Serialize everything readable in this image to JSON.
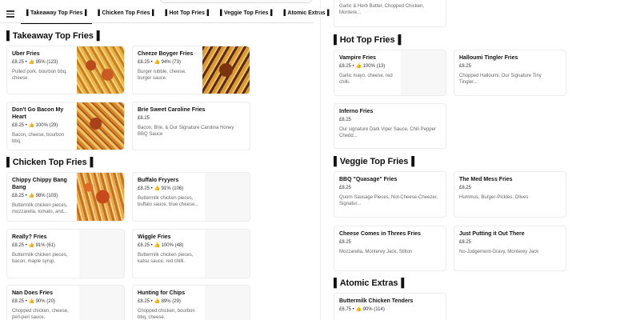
{
  "tabs": [
    {
      "label": "▌Takeaway Top Fries▐"
    },
    {
      "label": "▌Chicken Top Fries▐"
    },
    {
      "label": "▌Hot Top Fries▐"
    },
    {
      "label": "▌Veggie Top Fries▐"
    },
    {
      "label": "▌Atomic Extras▐"
    }
  ],
  "top_partial_card": {
    "desc": "Garlic & Herb Butter, Chopped Chicken, Montere..."
  },
  "sections": {
    "takeaway": {
      "title": "▌Takeaway Top Fries▐",
      "items": [
        {
          "name": "Uber Fries",
          "meta": "£8.25 • 👍 95% (123)",
          "desc": "Pulled pork, bourbon bbq, cheese."
        },
        {
          "name": "Cheeze Boyger Fries",
          "meta": "£8.25 • 👍 94% (73)",
          "desc": "Burger rubble, cheese, burger sauce."
        },
        {
          "name": "Don't Go Bacon My Heart",
          "meta": "£8.25 • 👍 100% (29)",
          "desc": "Bacon, cheese, bourbon bbq."
        },
        {
          "name": "Brie Sweet Caroline Fries",
          "meta": "£8.25",
          "desc": "Bacon, Brie, & Our Signature Carolina Honey BBQ Sauce"
        }
      ]
    },
    "chicken": {
      "title": "▌Chicken Top Fries▐",
      "items": [
        {
          "name": "Chippy Chippy Bang Bang",
          "meta": "£8.25 • 👍 98% (103)",
          "desc": "Buttermilk chicken pieces, mozzarella, tomato, and..."
        },
        {
          "name": "Buffalo Fryyers",
          "meta": "£8.25 • 👍 91% (106)",
          "desc": "Buttermilk chicken pieces, buffalo sauce, blue cheese..."
        },
        {
          "name": "Really? Fries",
          "meta": "£8.25 • 👍 91% (61)",
          "desc": "Buttermilk chicken pieces, bacon, maple syrup."
        },
        {
          "name": "Wiggle Fries",
          "meta": "£8.25 • 👍 100% (48)",
          "desc": "Buttermilk chicken pieces, katsu sauce, red chilli."
        },
        {
          "name": "Nan Does Fries",
          "meta": "£8.25 • 👍 90% (20)",
          "desc": "Chopped chicken, cheese, peri-peri sauce."
        },
        {
          "name": "Hunting for Chips",
          "meta": "£8.25 • 👍 89% (29)",
          "desc": "Chopped chicken, bourbon bbq, cheese."
        }
      ]
    },
    "hot": {
      "title": "▌Hot Top Fries▐",
      "items": [
        {
          "name": "Vampire Fries",
          "meta": "£8.25 • 👍 100% (13)",
          "desc": "Garlic mayo, cheese, red chilli."
        },
        {
          "name": "Halloumi Tingler Fries",
          "meta": "£8.25",
          "desc": "Chopped Halloumi, Our Signature Tiny Tingler..."
        },
        {
          "name": "Inferno Fries",
          "meta": "£8.25",
          "desc": "Our signature Dark Viper Sauce, Chili Pepper Chedd..."
        }
      ]
    },
    "veggie": {
      "title": "▌Veggie Top Fries▐",
      "items": [
        {
          "name": "BBQ \"Quasage\" Fries",
          "meta": "£8.25",
          "desc": "Quorn Sausage Pieces, Not-Cheese-Cheezer, Signatur..."
        },
        {
          "name": "The Med Mess Fries",
          "meta": "£8.25",
          "desc": "Hummus, Burger-Pickles, Olives"
        },
        {
          "name": "Cheese Comes in Threes Fries",
          "meta": "£8.25",
          "desc": "Mozzarella, Monterey Jack, Stilton"
        },
        {
          "name": "Just Putting it Out There",
          "meta": "£8.25",
          "desc": "No-Judgement-Gravy, Monterey Jack"
        }
      ]
    },
    "atomic": {
      "title": "▌Atomic Extras▐",
      "items": [
        {
          "name": "Buttermilk Chicken Tenders",
          "meta": "£6.75 • 👍 90% (114)",
          "desc": ""
        }
      ]
    }
  }
}
